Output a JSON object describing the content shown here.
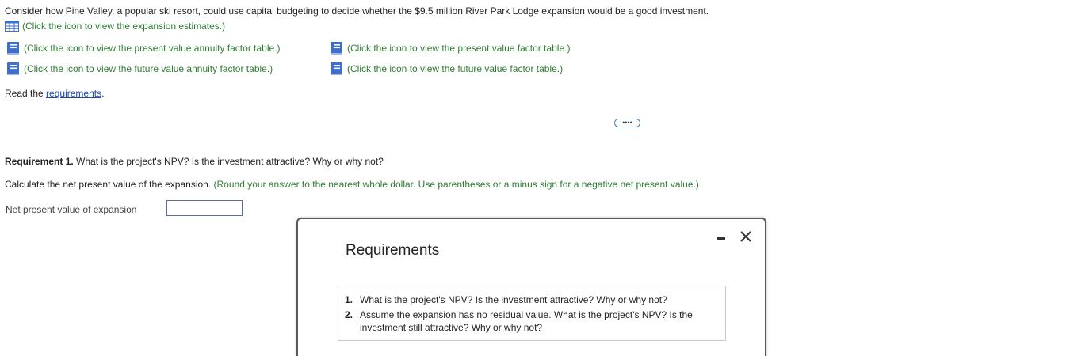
{
  "intro": "Consider how Pine Valley, a popular ski resort, could use capital budgeting to decide whether the $9.5 million River Park Lodge expansion would be a good investment.",
  "links": {
    "expansion_estimates": "(Click the icon to view the expansion estimates.)",
    "pv_annuity": "(Click the icon to view the present value annuity factor table.)",
    "pv_factor": "(Click the icon to view the present value factor table.)",
    "fv_annuity": "(Click the icon to view the future value annuity factor table.)",
    "fv_factor": "(Click the icon to view the future value factor table.)"
  },
  "read": {
    "prefix": "Read the ",
    "link": "requirements",
    "suffix": "."
  },
  "more_button": "••••",
  "requirement1": {
    "label": "Requirement 1.",
    "question": " What is the project's NPV? Is the investment attractive? Why or why not?"
  },
  "calc": {
    "text": "Calculate the net present value of the expansion. ",
    "hint": "(Round your answer to the nearest whole dollar. Use parentheses or a minus sign for a negative net present value.)"
  },
  "npv": {
    "label": "Net present value of expansion",
    "value": ""
  },
  "modal": {
    "title": "Requirements",
    "items": [
      {
        "num": "1.",
        "text": "What is the project's NPV? Is the investment attractive? Why or why not?"
      },
      {
        "num": "2.",
        "text": "Assume the expansion has no residual value. What is the project's NPV? Is the investment still attractive? Why or why not?"
      }
    ]
  },
  "colors": {
    "link_green": "#2e7d32",
    "link_blue": "#1a47b8",
    "icon_blue": "#3d6fd1"
  },
  "icons": [
    "grid-table-icon",
    "book-icon",
    "minimize-icon",
    "close-icon"
  ]
}
